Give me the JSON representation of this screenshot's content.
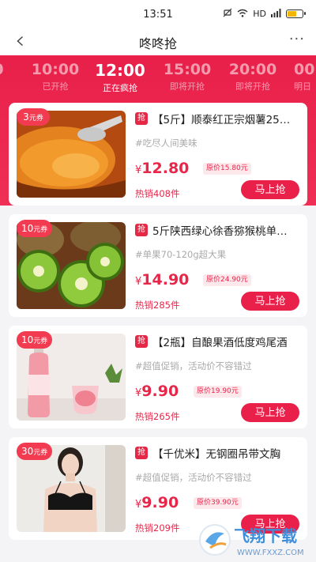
{
  "status_bar": {
    "time": "13:51",
    "network": "HD"
  },
  "header": {
    "title": "咚咚抢",
    "more": "···"
  },
  "time_tabs": [
    {
      "time": "0",
      "status": ""
    },
    {
      "time": "10:00",
      "status": "已开抢"
    },
    {
      "time": "12:00",
      "status": "正在疯抢",
      "active": true
    },
    {
      "time": "15:00",
      "status": "即将开抢"
    },
    {
      "time": "20:00",
      "status": "即将开抢"
    },
    {
      "time": "00",
      "status": "明日"
    }
  ],
  "products": [
    {
      "coupon_value": "3",
      "coupon_unit": "元券",
      "icon": "抢",
      "title": "【5斤】顺泰红正宗烟薯25…",
      "tag": "#吃尽人间美味",
      "yen": "¥",
      "price": "12.80",
      "original_price": "原价15.80元",
      "sold": "热销408件",
      "button": "马上抢",
      "image": "sweet-potato"
    },
    {
      "coupon_value": "10",
      "coupon_unit": "元券",
      "icon": "抢",
      "title": "5斤陕西绿心徐香猕猴桃单…",
      "tag": "#单果70-120g超大果",
      "yen": "¥",
      "price": "14.90",
      "original_price": "原价24.90元",
      "sold": "热销285件",
      "button": "马上抢",
      "image": "kiwi"
    },
    {
      "coupon_value": "10",
      "coupon_unit": "元券",
      "icon": "抢",
      "title": "【2瓶】自酿果酒低度鸡尾酒",
      "tag": "#超值促销，活动价不容错过",
      "yen": "¥",
      "price": "9.90",
      "original_price": "原价19.90元",
      "sold": "热销265件",
      "button": "马上抢",
      "image": "fruit-wine"
    },
    {
      "coupon_value": "30",
      "coupon_unit": "元券",
      "icon": "抢",
      "title": "【千优米】无钢圈吊带文胸",
      "tag": "#超值促销，活动价不容错过",
      "yen": "¥",
      "price": "9.90",
      "original_price": "原价39.90元",
      "sold": "热销209件",
      "button": "马上抢",
      "image": "bra"
    }
  ],
  "watermark": {
    "text": "飞翔下载",
    "url_text": "WWW.FXXZ.COM"
  },
  "colors": {
    "accent": "#e8204a",
    "tag_gray": "#aaaaaa",
    "background": "#f4f4f6"
  }
}
